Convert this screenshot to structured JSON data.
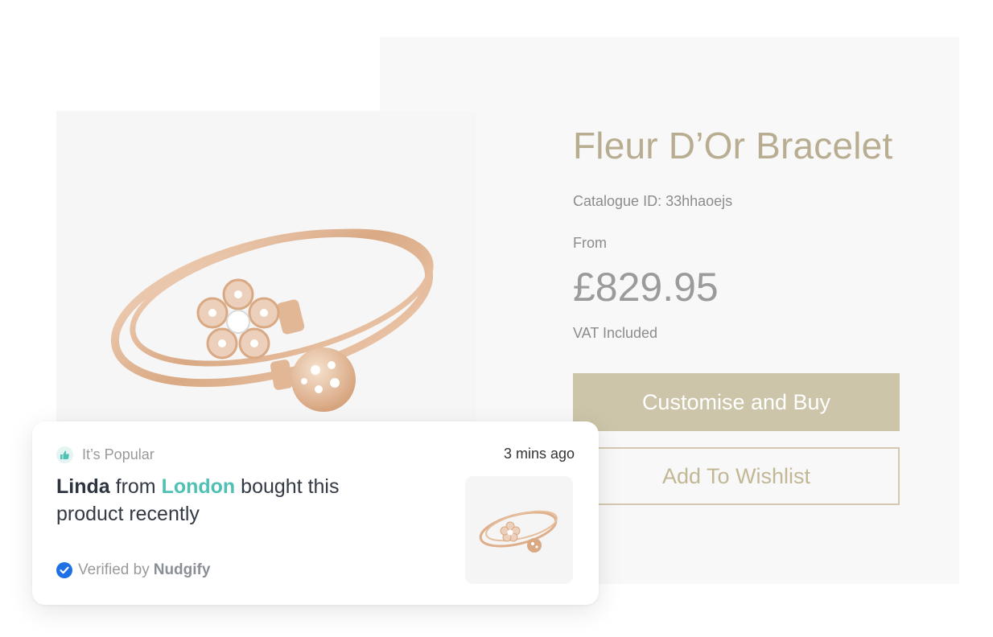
{
  "product": {
    "title": "Fleur D’Or Bracelet",
    "catalogue_id": "Catalogue ID: 33hhaoejs",
    "price_prefix": "From",
    "price": "£829.95",
    "vat_note": "VAT Included",
    "buy_label": "Customise and Buy",
    "wishlist_label": "Add To Wishlist",
    "image_icon": "gold-flower-bracelet"
  },
  "notification": {
    "badge_label": "It’s Popular",
    "time_ago": "3 mins ago",
    "name": "Linda",
    "from_word": "from",
    "city": "London",
    "message_tail": "bought this product recently",
    "verified_label": "Verified by",
    "verified_brand": "Nudgify"
  },
  "colors": {
    "accent_gold": "#cdc5a9",
    "title_gold": "#b8ad90",
    "city_teal": "#4ec0b4",
    "verified_blue": "#1f6fe5"
  }
}
